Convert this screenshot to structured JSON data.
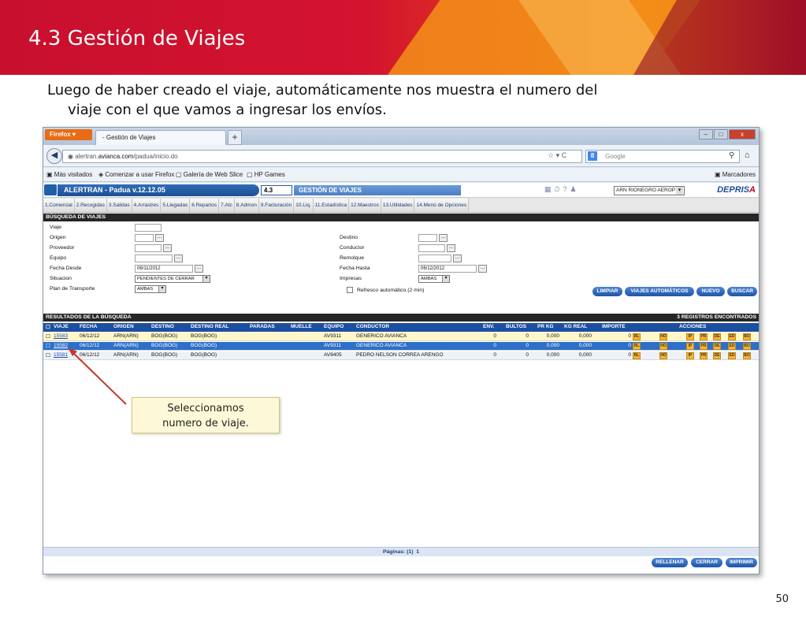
{
  "slide": {
    "title": "4.3 Gestión de Viajes",
    "intro_line1": "Luego de haber creado el viaje, automáticamente nos muestra  el numero del",
    "intro_line2": "viaje con el que vamos a ingresar los envíos.",
    "page_number": "50",
    "callout_line1": "Seleccionamos",
    "callout_line2": "numero de viaje."
  },
  "browser": {
    "app_button": "Firefox ▾",
    "tab_title": "- Gestión de Viajes",
    "tab_add": "+",
    "url_prefix": "alertran.",
    "url_domain": "avianca.com",
    "url_path": "/padua/inicio.do",
    "search_placeholder": "Google",
    "window_controls": [
      "–",
      "□",
      "x"
    ],
    "bookmarks": [
      "Más visitados",
      "Comenzar a usar Firefox",
      "Galería de Web Slice",
      "HP Games"
    ],
    "bookmarks_menu": "Marcadores"
  },
  "app": {
    "title": "ALERTRAN - Padua  v.12.12.05",
    "module_code": "4.3",
    "module_title": "GESTIÓN DE VIAJES",
    "office": "ARN RIONEGRO AEROP",
    "brand": "DEPRIS",
    "brand_accent": "A",
    "menu": [
      "1.Comercial",
      "2.Recogidas",
      "3.Salidas",
      "4.Arrastres",
      "5.Llegadas",
      "6.Repartos",
      "7.Atc",
      "8.Admon",
      "9.Facturación",
      "10.Liq.",
      "11.Estadística",
      "12.Maestros",
      "13.Utilidades",
      "14.Menú de Opciones"
    ]
  },
  "search": {
    "header": "BÚSQUEDA DE VIAJES",
    "labels": {
      "viaje": "Viaje",
      "origen": "Origen",
      "proveedor": "Proveedor",
      "equipo": "Equipo",
      "fecha_desde": "Fecha Desde",
      "situacion": "Situacion",
      "plan": "Plan de Transporte",
      "destino": "Destino",
      "conductor": "Conductor",
      "remolque": "Remolque",
      "fecha_hasta": "Fecha Hasta",
      "impresas": "Impresas",
      "refresco": "Refresco automático (2 min)"
    },
    "values": {
      "fecha_desde": "06/11/2012",
      "fecha_hasta": "06/12/2012",
      "situacion": "PENDIENTES DE CERRAR",
      "plan": "AMBAS",
      "impresas": "AMBAS"
    },
    "buttons": {
      "limpiar": "LIMPIAR",
      "viajes_auto": "VIAJES AUTOMÁTICOS",
      "nuevo": "NUEVO",
      "buscar": "BUSCAR"
    }
  },
  "results": {
    "header": "RESULTADOS DE LA BÚSQUEDA",
    "count": "3 REGISTROS ENCONTRADOS",
    "columns": [
      "VIAJE",
      "FECHA",
      "ORIGEN",
      "DESTINO",
      "DESTINO REAL",
      "PARADAS",
      "MUELLE",
      "EQUIPO",
      "CONDUCTOR",
      "ENV.",
      "BULTOS",
      "PR KG",
      "KG REAL",
      "IMPORTE",
      "ACCIONES"
    ],
    "rows": [
      {
        "viaje": "15583",
        "fecha": "06/12/12",
        "origen": "ARN(ARN)",
        "destino": "BOG(BOG)",
        "destino_real": "BOG(BOG)",
        "equipo": "AV9311",
        "conductor": "GENERICO AVIANCA",
        "env": "0",
        "bultos": "0",
        "pr_kg": "0,000",
        "kg_real": "0,000",
        "importe": "0"
      },
      {
        "viaje": "15582",
        "fecha": "06/12/12",
        "origen": "ARN(ARN)",
        "destino": "BOG(BOG)",
        "destino_real": "BOG(BOG)",
        "equipo": "AV9311",
        "conductor": "GENERICO AVIANCA",
        "env": "0",
        "bultos": "0",
        "pr_kg": "0,000",
        "kg_real": "0,000",
        "importe": "0"
      },
      {
        "viaje": "15581",
        "fecha": "06/12/12",
        "origen": "ARN(ARN)",
        "destino": "BOG(BOG)",
        "destino_real": "BOG(BOG)",
        "equipo": "AV8405",
        "conductor": "PEDRO NELSON CORREA ARENGO",
        "env": "0",
        "bultos": "0",
        "pr_kg": "0,000",
        "kg_real": "0,000",
        "importe": "0"
      }
    ],
    "actions": [
      "RL",
      "HO",
      "IP",
      "PR",
      "DE",
      "ED",
      "BO"
    ],
    "pager_label": "Páginas: (1)",
    "pager_current": "1"
  },
  "footer_buttons": {
    "rellenar": "RELLENAR",
    "cerrar": "CERRAR",
    "imprimir": "IMPRIMIR"
  },
  "colors": {
    "header_red": "#c8102e",
    "app_blue": "#1c4fa0",
    "selected_row": "#2e6fc8",
    "highlight_row": "#fff7c8",
    "action_orange": "#f7b431"
  }
}
